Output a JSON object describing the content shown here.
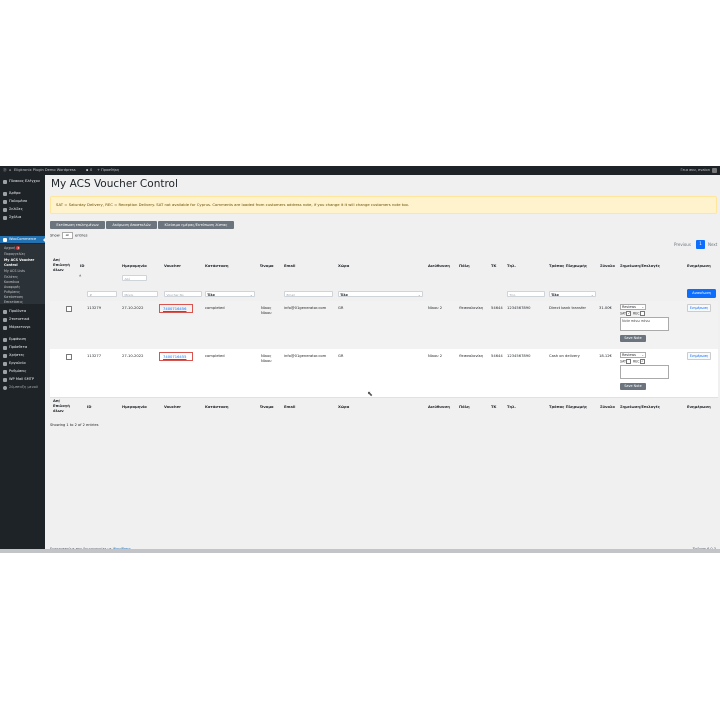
{
  "admin_bar": {
    "site_name": "Eligkronix Plugin Demo Wordpress",
    "comments_count": "0",
    "new_label": "Προσθήκη",
    "greeting": "Γεια σου, evalon"
  },
  "sidebar": {
    "items": [
      {
        "label": "Πίνακας Ελέγχου",
        "icon": "dashboard-icon"
      },
      {
        "label": "Άρθρα",
        "icon": "pin-icon"
      },
      {
        "label": "Πολυμέσα",
        "icon": "media-icon"
      },
      {
        "label": "Σελίδες",
        "icon": "page-icon"
      },
      {
        "label": "Σχόλια",
        "icon": "comment-icon"
      },
      {
        "label": "WooCommerce",
        "icon": "woo-icon"
      }
    ],
    "woo_sub": [
      {
        "label": "Αρχική",
        "badge": "3"
      },
      {
        "label": "Παραγγελίες"
      },
      {
        "label": "My ACS Voucher Control"
      },
      {
        "label": "My ACS Lists"
      },
      {
        "label": "Πελάτες"
      },
      {
        "label": "Κουπόνια"
      },
      {
        "label": "Αναφορές"
      },
      {
        "label": "Ρυθμίσεις"
      },
      {
        "label": "Κατάσταση"
      },
      {
        "label": "Επεκτάσεις"
      }
    ],
    "items_after": [
      {
        "label": "Προϊόντα",
        "icon": "box-icon"
      },
      {
        "label": "Στατιστικά",
        "icon": "chart-icon"
      },
      {
        "label": "Μάρκετινγκ",
        "icon": "megaphone-icon"
      },
      {
        "label": "Εμφάνιση",
        "icon": "brush-icon"
      },
      {
        "label": "Πρόσθετα",
        "icon": "plugin-icon"
      },
      {
        "label": "Χρήστες",
        "icon": "user-icon"
      },
      {
        "label": "Εργαλεία",
        "icon": "wrench-icon"
      },
      {
        "label": "Ρυθμίσεις",
        "icon": "settings-icon"
      },
      {
        "label": "WP Mail SMTP",
        "icon": "mail-icon"
      },
      {
        "label": "Σύμπτυξη μενού",
        "icon": "collapse-icon"
      }
    ]
  },
  "page": {
    "title": "My ACS Voucher Control",
    "alert": "SAT = Saturday Delivery, REC = Reception Delivery. SAT not available for Cyprus. Comments are loaded from customers address note, if you change it it will change customers note too.",
    "buttons": [
      "Εκτύπωση επιλεγμένων",
      "Ακύρωση Αποστολών",
      "Κλείσιμο ημέρας/Εκτύπωση λίστας"
    ],
    "show_label": "Show",
    "show_value": "all",
    "entries_label": "entries",
    "pager": {
      "previous": "Previous",
      "current": "1",
      "next": "Next"
    },
    "columns": [
      "Απ/Επιλογή όλων",
      "ID",
      "Ημερομηνία",
      "Voucher",
      "Κατάσταση",
      "Όνομα",
      "Email",
      "Χώρα",
      "Διεύθυνση",
      "Πόλη",
      "ΤΚ",
      "Τηλ.",
      "Τρόπος Πληρωμής",
      "Σύνολο",
      "Σημείωση/Επιλογές",
      "Ενημέρωση"
    ],
    "filters": {
      "id": "#",
      "date_from": "Από",
      "date_to": "Μέχρι",
      "voucher": "Voucher No",
      "status": "Όλα",
      "email": "Email",
      "country": "Όλα",
      "phone": "Τηλ.",
      "payment": "Όλα"
    },
    "update_all_button": "Ανανέωση",
    "rows": [
      {
        "id": "113279",
        "date": "27-10-2022",
        "voucher": "7400716456",
        "status": "completed",
        "name": "Νίκος Νίκου",
        "email": "info@01generator.com",
        "country": "GR",
        "address": "Νίκου 2",
        "city": "Θεσσαλονίκη",
        "zip": "54644",
        "phone": "1234567890",
        "payment": "Direct bank transfer",
        "total": "31.00€",
        "note_select": "Reviews",
        "sat_label": "SAT",
        "rec_label": "REC",
        "sat_checked": "✓",
        "rec_checked": "",
        "note_text": "Note πάνω πάνω",
        "save_note": "Save Note",
        "update": "Ενημέρωση"
      },
      {
        "id": "113277",
        "date": "27-10-2022",
        "voucher": "7400716455",
        "status": "completed",
        "name": "Νίκος Νίκου",
        "email": "info@01generator.com",
        "country": "GR",
        "address": "Νίκου 2",
        "city": "Θεσσαλονίκη",
        "zip": "54644",
        "phone": "1234567890",
        "payment": "Cash on delivery",
        "total": "18.12€",
        "note_select": "Reviews",
        "sat_label": "SAT",
        "rec_label": "REC",
        "sat_checked": "",
        "rec_checked": "✓",
        "note_text": "",
        "save_note": "Save Note",
        "update": "Ενημέρωση"
      }
    ],
    "showing": "Showing 1 to 2 of 2 entries"
  },
  "footer": {
    "thanks_prefix": "Ευχαριστούμε που δημιουργείτε με ",
    "thanks_link": "WordPress",
    "version": "Έκδοση 6.0.3"
  },
  "colors": {
    "accent": "#0d6efd",
    "wp_blue": "#2271b1",
    "sidebar": "#1d2327",
    "alert_bg": "#fff3cd"
  }
}
